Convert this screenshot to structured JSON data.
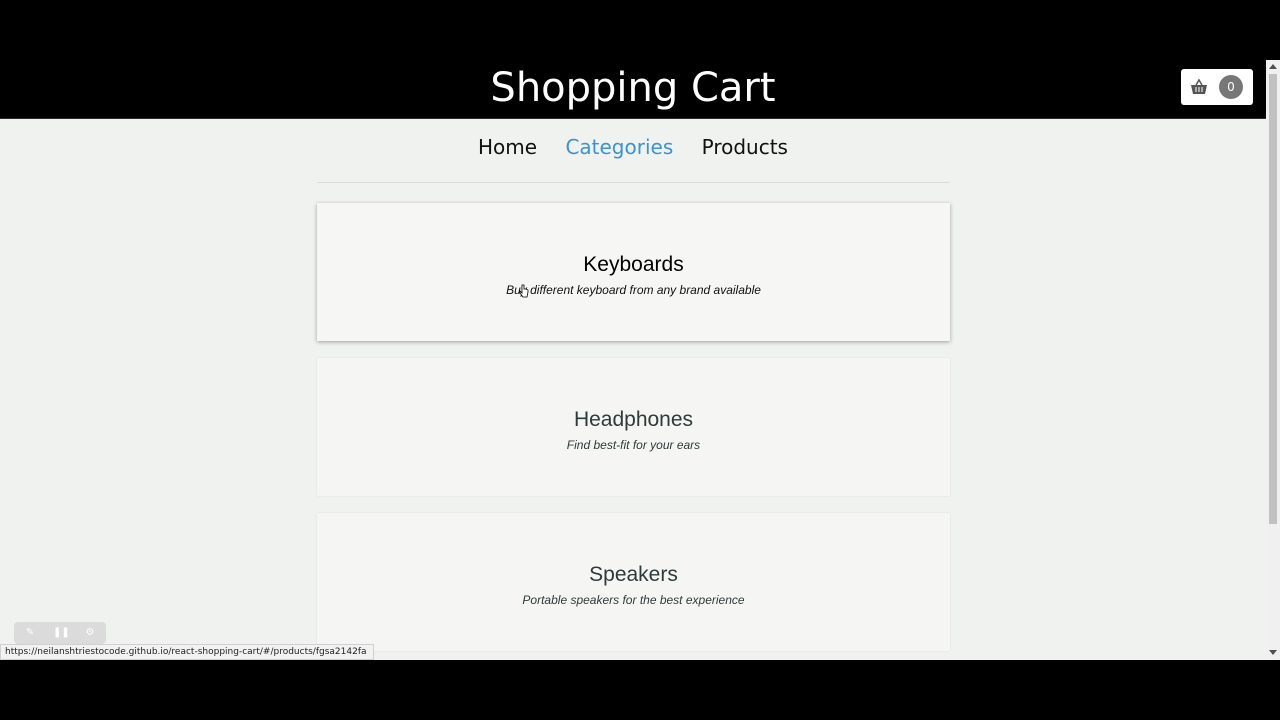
{
  "header": {
    "title": "Shopping Cart",
    "cart_count": "0",
    "cart_icon": "basket-icon"
  },
  "nav": {
    "items": [
      {
        "label": "Home",
        "active": false
      },
      {
        "label": "Categories",
        "active": true
      },
      {
        "label": "Products",
        "active": false
      }
    ],
    "active_color": "#3a93d6"
  },
  "categories": [
    {
      "title": "Keyboards",
      "description": "Buy different keyboard from any brand available"
    },
    {
      "title": "Headphones",
      "description": "Find best-fit for your ears"
    },
    {
      "title": "Speakers",
      "description": "Portable speakers for the best experience"
    }
  ],
  "status_bar": {
    "url": "https://neilanshtriestocode.github.io/react-shopping-cart/#/products/fgsa2142fa"
  },
  "recorder": {
    "icons": [
      "edit-icon",
      "pause-icon",
      "settings-icon"
    ]
  }
}
